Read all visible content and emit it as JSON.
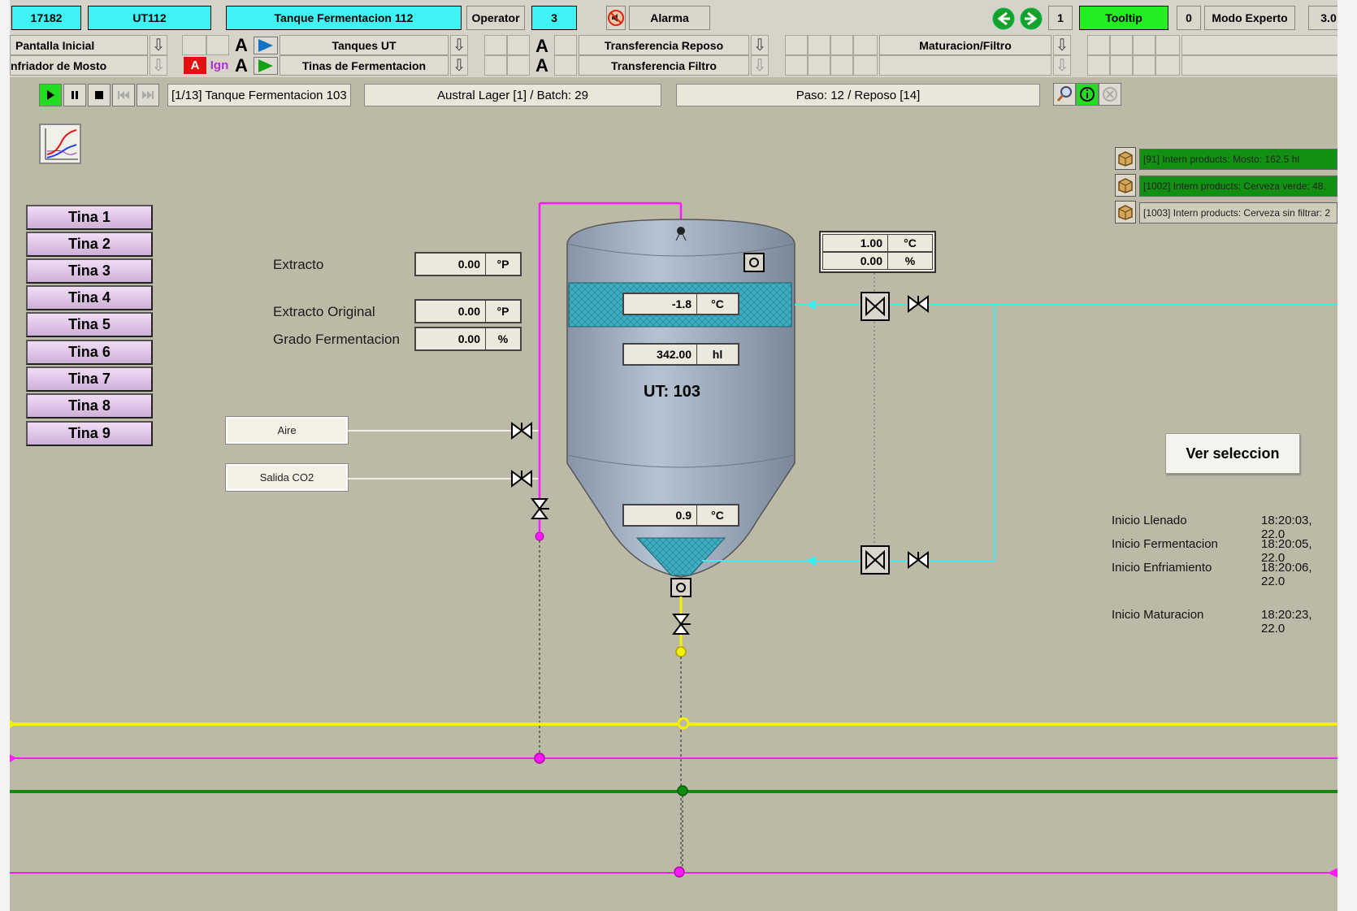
{
  "topbar": {
    "id": "17182",
    "unit": "UT112",
    "title": "Tanque Fermentacion 112",
    "role": "Operator",
    "level": "3",
    "alarm": "Alarma",
    "counter1": "1",
    "tooltip": "Tooltip",
    "counter2": "0",
    "mode": "Modo Experto",
    "version": "3.0"
  },
  "menu": {
    "row1": {
      "left": "Pantalla Inicial",
      "tanques": "Tanques UT",
      "transfer": "Transferencia Reposo",
      "matur": "Maturacion/Filtro"
    },
    "row2": {
      "left": "nfriador de Mosto",
      "tinas": "Tinas de Fermentacion",
      "transfer": "Transferencia Filtro",
      "red_a": "A",
      "ign": "Ign"
    },
    "a_label": "A"
  },
  "process": {
    "step_counter": "[1/13] Tanque Fermentacion 103",
    "batch": "Austral Lager [1]  /  Batch: 29",
    "paso": "Paso: 12  /  Reposo [14]"
  },
  "tinas": [
    "Tina 1",
    "Tina 2",
    "Tina 3",
    "Tina 4",
    "Tina 5",
    "Tina 6",
    "Tina 7",
    "Tina 8",
    "Tina 9"
  ],
  "params": {
    "extracto": {
      "label": "Extracto",
      "value": "0.00",
      "unit": "°P"
    },
    "extracto_original": {
      "label": "Extracto Original",
      "value": "0.00",
      "unit": "°P"
    },
    "grado": {
      "label": "Grado Fermentacion",
      "value": "0.00",
      "unit": "%"
    }
  },
  "inputs": {
    "aire": "Aire",
    "co2": "Salida CO2"
  },
  "tank": {
    "jacket_temp": {
      "value": "-1.8",
      "unit": "°C"
    },
    "volume": {
      "value": "342.00",
      "unit": "hl"
    },
    "ut_label": "UT:  103",
    "cone_temp": {
      "value": "0.9",
      "unit": "°C"
    }
  },
  "setpoint": {
    "temp": {
      "value": "1.00",
      "unit": "°C"
    },
    "pct": {
      "value": "0.00",
      "unit": "%"
    }
  },
  "products": [
    {
      "text": "[91] Intern products: Mosto: 162.5 hl",
      "color": "#119011"
    },
    {
      "text": "[1002] Intern products: Cerveza verde: 48.",
      "color": "#119011"
    },
    {
      "text": "[1003] Intern products: Cerveza sin filtrar: 2",
      "color": "#d0cdbd"
    }
  ],
  "ver_seleccion": "Ver seleccion",
  "events": [
    {
      "label": "Inicio Llenado",
      "time": "18:20:03, 22.0"
    },
    {
      "label": "Inicio Fermentacion",
      "time": "18:20:05, 22.0"
    },
    {
      "label": "Inicio Enfriamiento",
      "time": "18:20:06, 22.0"
    },
    {
      "label": "Inicio Maturacion",
      "time": "18:20:23, 22.0"
    }
  ],
  "colors": {
    "magenta": "#ff1aff",
    "cyan": "#38f0f4",
    "yellow": "#f2f200",
    "green": "#128a12",
    "background": "#bcbaa6"
  }
}
